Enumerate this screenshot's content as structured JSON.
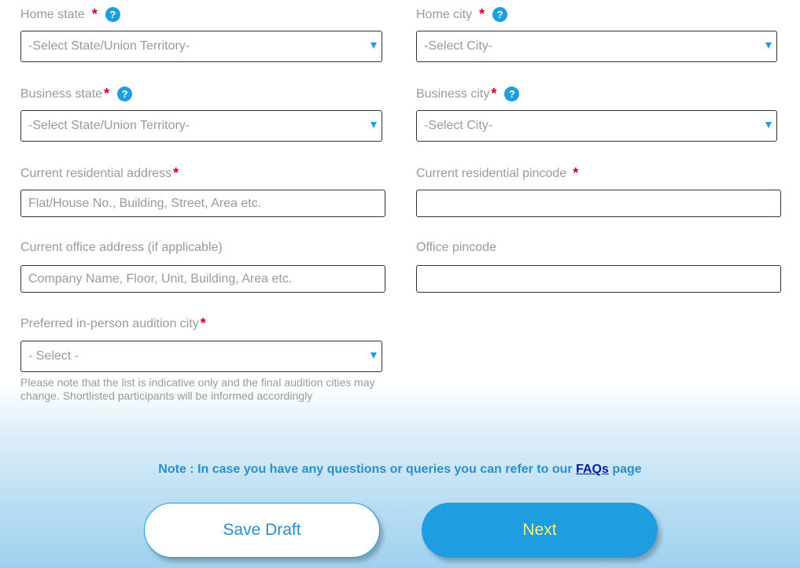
{
  "form": {
    "home_state": {
      "label": "Home state",
      "value": "-Select State/Union Territory-"
    },
    "home_city": {
      "label": "Home city",
      "value": "-Select City-"
    },
    "business_state": {
      "label": "Business state",
      "value": "-Select State/Union Territory-"
    },
    "business_city": {
      "label": "Business city",
      "value": "-Select City-"
    },
    "residential_address": {
      "label": "Current residential address",
      "placeholder": "Flat/House No., Building, Street, Area etc."
    },
    "residential_pincode": {
      "label": "Current residential pincode",
      "value": ""
    },
    "office_address": {
      "label": "Current office address (if applicable)",
      "placeholder": "Company Name, Floor, Unit, Building, Area etc."
    },
    "office_pincode": {
      "label": "Office pincode",
      "value": ""
    },
    "audition_city": {
      "label": "Preferred in-person audition city",
      "value": "- Select -",
      "hint_line1": "Please note that the list is indicative only and the final audition cities may",
      "hint_line2": "change. Shortlisted participants will be informed accordingly"
    },
    "required_mark": "*",
    "help_glyph": "?"
  },
  "note": {
    "prefix": "Note : In case you have any questions or queries you can refer to our ",
    "link": "FAQs",
    "suffix": " page"
  },
  "buttons": {
    "save_draft": "Save Draft",
    "next": "Next"
  },
  "colors": {
    "accent": "#1e9ee1",
    "required": "#d0021b",
    "next_text": "#f0f27a"
  }
}
